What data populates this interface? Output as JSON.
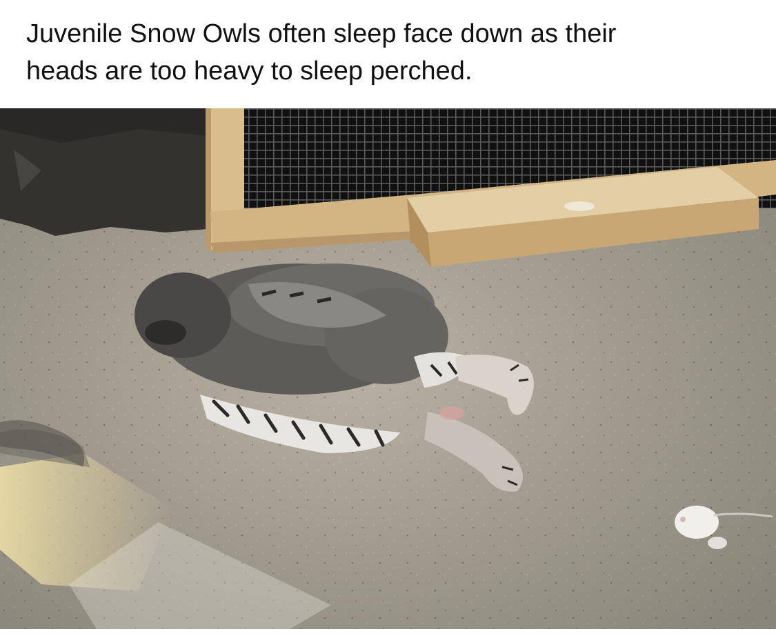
{
  "post": {
    "caption_line1": "Juvenile Snow Owls often sleep face down as their",
    "caption_line2": "heads are too heavy to sleep perched."
  },
  "photo": {
    "subject": "owl-icon",
    "colors": {
      "sand": "#b9b2a4",
      "wall": "#2e2d2c",
      "mesh": "#121212",
      "wood": "#d7b98a",
      "owl_down": "#5f5d5a",
      "owl_wing_light": "#e9e7e4"
    }
  }
}
